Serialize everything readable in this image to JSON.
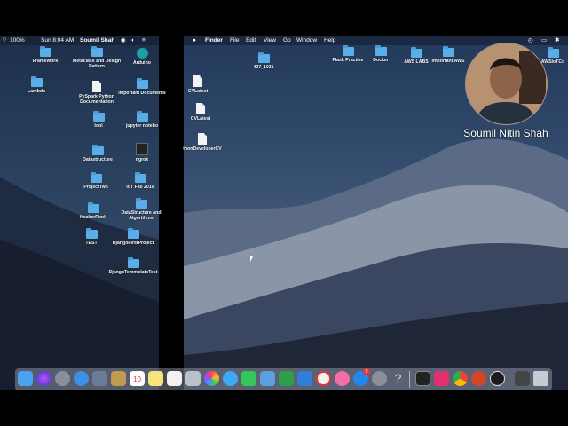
{
  "left_menubar": {
    "battery": "100%",
    "clock": "Sun 8:04 AM",
    "user": "Soumil Shah"
  },
  "right_menubar": {
    "apple_menu": "",
    "items": [
      "Finder",
      "File",
      "Edit",
      "View",
      "Go",
      "Window",
      "Help"
    ]
  },
  "left_desktop_icons": [
    {
      "label": "FrameWork",
      "kind": "folder"
    },
    {
      "label": "Metaclass and Design Pattern",
      "kind": "folder"
    },
    {
      "label": "Arduino",
      "kind": "app"
    },
    {
      "label": "Lambda",
      "kind": "folder"
    },
    {
      "label": "PySpark Python Documentation",
      "kind": "doc"
    },
    {
      "label": "Important Documents",
      "kind": "folder"
    },
    {
      "label": "tool",
      "kind": "folder"
    },
    {
      "label": "jupyter notebo",
      "kind": "folder"
    },
    {
      "label": "Datastructure",
      "kind": "folder"
    },
    {
      "label": "ngrok",
      "kind": "exec"
    },
    {
      "label": "ProjectTwo",
      "kind": "folder"
    },
    {
      "label": "IoT Fall 2019",
      "kind": "folder"
    },
    {
      "label": "HackerRank",
      "kind": "folder"
    },
    {
      "label": "DataStructure and Algorithms",
      "kind": "folder"
    },
    {
      "label": "TEST",
      "kind": "folder"
    },
    {
      "label": "DjangoFirstProject",
      "kind": "folder"
    },
    {
      "label": "DjangoTemmplateTest",
      "kind": "folder"
    }
  ],
  "right_desktop_icons": [
    {
      "label": "427_1031",
      "kind": "folder"
    },
    {
      "label": "Flask Practise",
      "kind": "folder"
    },
    {
      "label": "Docker",
      "kind": "folder"
    },
    {
      "label": "AWS LABS",
      "kind": "folder"
    },
    {
      "label": "Important AWS",
      "kind": "folder"
    },
    {
      "label": "AWSIoTCo",
      "kind": "folder"
    },
    {
      "label": "CVLatest",
      "kind": "doc"
    },
    {
      "label": "CVLatest",
      "kind": "doc"
    },
    {
      "label": "thonDeveloperCV",
      "kind": "doc"
    }
  ],
  "webcam": {
    "name": "Soumil Nitin Shah"
  },
  "dock": {
    "apps": [
      "finder-icon",
      "siri-icon",
      "launchpad-icon",
      "safari-icon",
      "preview-icon",
      "notes-icon",
      "calendar-icon",
      "stickies-icon",
      "reminders-icon",
      "photo-booth-icon",
      "photos-icon",
      "messages-icon",
      "facetime-icon",
      "preview-docs-icon",
      "numbers-icon",
      "keynote-icon",
      "news-icon",
      "music-icon",
      "app-store-icon",
      "system-preferences-icon",
      "help-icon",
      "terminal-icon",
      "intellij-icon",
      "chrome-icon",
      "powerpoint-icon",
      "obs-icon",
      "trash-icon"
    ],
    "calendar_day": "10",
    "app_store_badge": "9"
  }
}
